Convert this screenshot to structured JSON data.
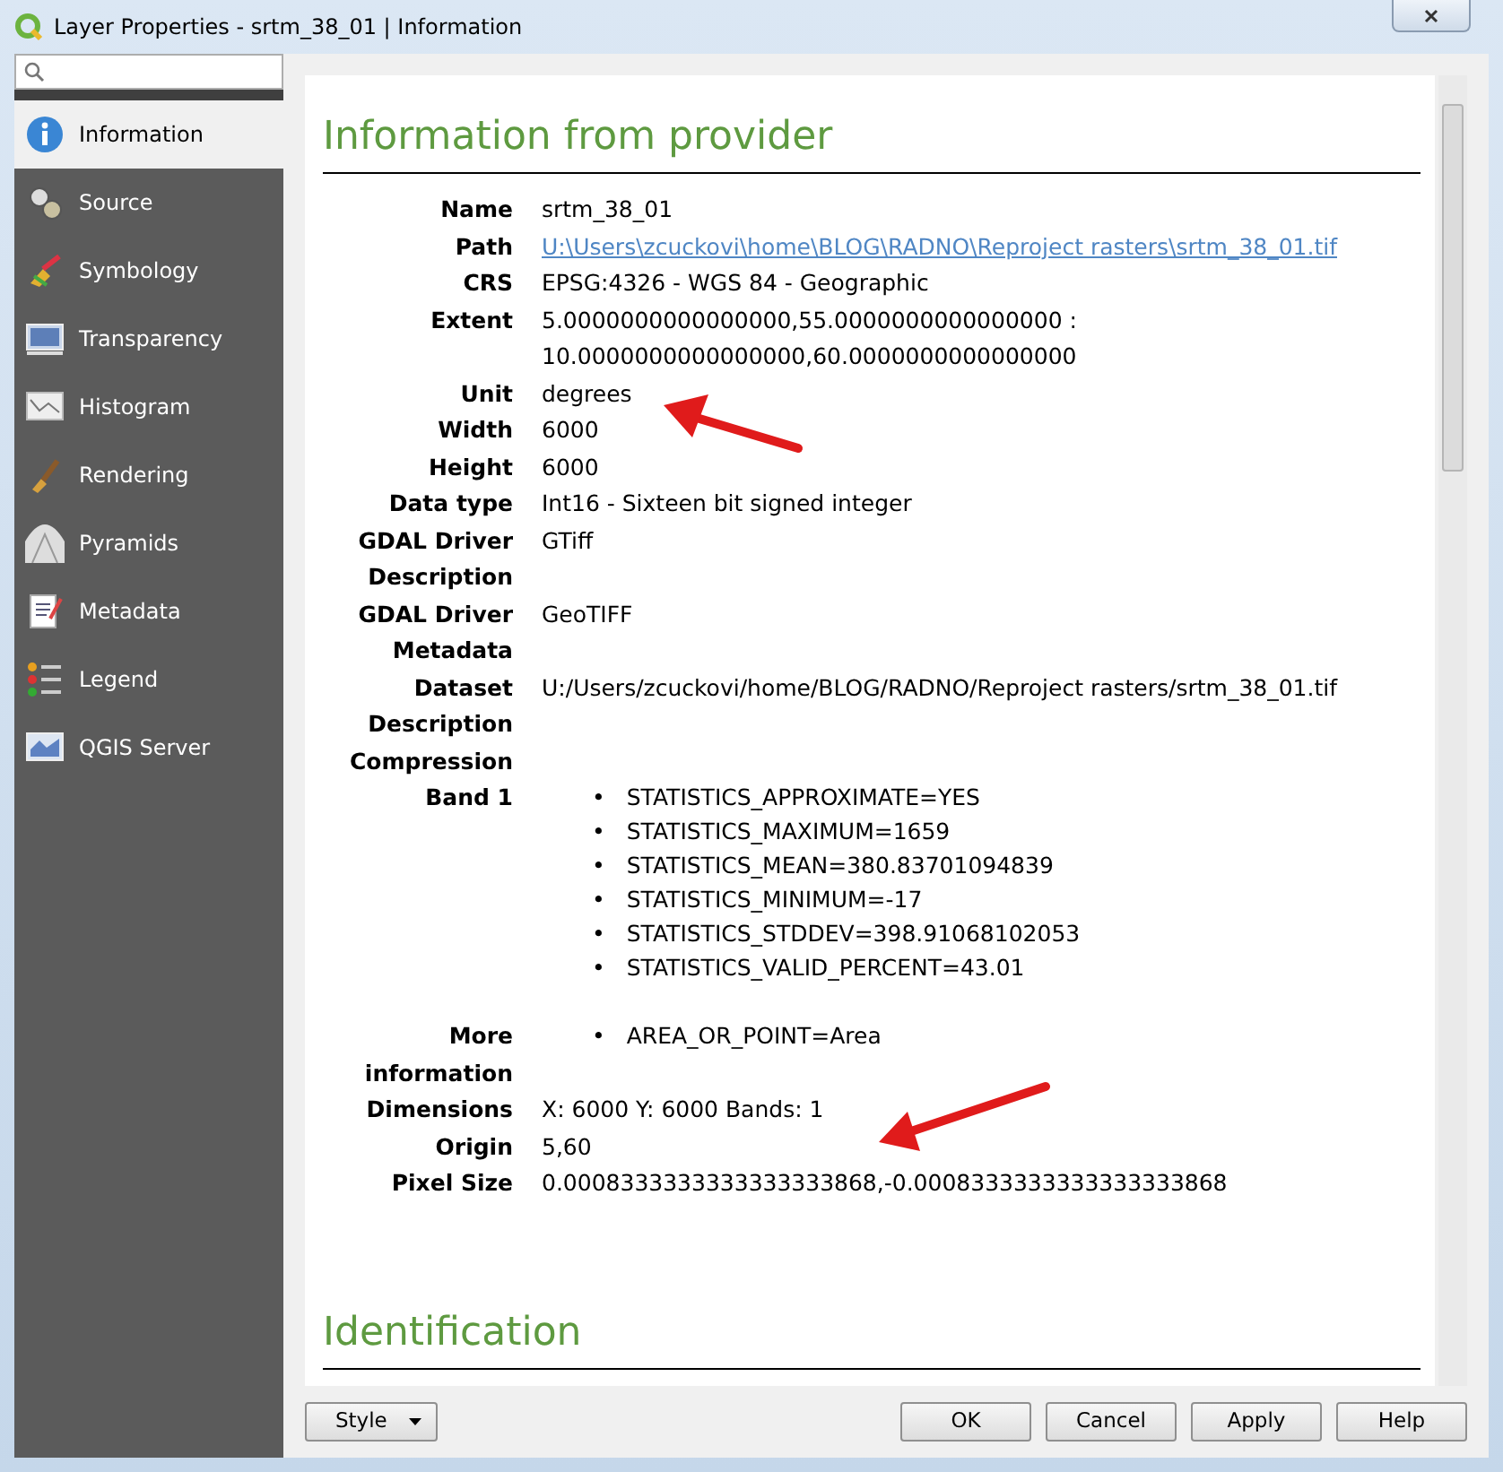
{
  "window": {
    "title": "Layer Properties - srtm_38_01 | Information"
  },
  "sidebar": {
    "items": [
      {
        "label": "Information",
        "selected": true
      },
      {
        "label": "Source",
        "selected": false
      },
      {
        "label": "Symbology",
        "selected": false
      },
      {
        "label": "Transparency",
        "selected": false
      },
      {
        "label": "Histogram",
        "selected": false
      },
      {
        "label": "Rendering",
        "selected": false
      },
      {
        "label": "Pyramids",
        "selected": false
      },
      {
        "label": "Metadata",
        "selected": false
      },
      {
        "label": "Legend",
        "selected": false
      },
      {
        "label": "QGIS Server",
        "selected": false
      }
    ]
  },
  "sections": [
    {
      "heading": "Information from provider",
      "rows": [
        {
          "label": "Name",
          "kind": "text",
          "value": "srtm_38_01"
        },
        {
          "label": "Path",
          "kind": "link",
          "value": "U:\\Users\\zcuckovi\\home\\BLOG\\RADNO\\Reproject rasters\\srtm_38_01.tif"
        },
        {
          "label": "CRS",
          "kind": "text",
          "value": "EPSG:4326 - WGS 84 - Geographic"
        },
        {
          "label": "Extent",
          "kind": "lines",
          "lines": [
            "5.0000000000000000,55.0000000000000000 :",
            "10.0000000000000000,60.0000000000000000"
          ]
        },
        {
          "label": "Unit",
          "kind": "text",
          "value": "degrees"
        },
        {
          "label": "Width",
          "kind": "text",
          "value": "6000"
        },
        {
          "label": "Height",
          "kind": "text",
          "value": "6000"
        },
        {
          "label": "Data type",
          "kind": "text",
          "value": "Int16 - Sixteen bit signed integer"
        },
        {
          "label": "GDAL Driver Description",
          "kind": "text",
          "value": "GTiff"
        },
        {
          "label": "GDAL Driver Metadata",
          "kind": "text",
          "value": "GeoTIFF"
        },
        {
          "label": "Dataset Description",
          "kind": "text",
          "value": "U:/Users/zcuckovi/home/BLOG/RADNO/Reproject rasters/srtm_38_01.tif"
        },
        {
          "label": "Compression",
          "kind": "empty"
        },
        {
          "label": "Band 1",
          "kind": "list",
          "bullet": "•",
          "items": [
            "STATISTICS_APPROXIMATE=YES",
            "STATISTICS_MAXIMUM=1659",
            "STATISTICS_MEAN=380.83701094839",
            "STATISTICS_MINIMUM=-17",
            "STATISTICS_STDDEV=398.91068102053",
            "STATISTICS_VALID_PERCENT=43.01"
          ]
        },
        {
          "label": "More information",
          "kind": "list",
          "bullet": "•",
          "items": [
            "AREA_OR_POINT=Area"
          ]
        },
        {
          "label": "Dimensions",
          "kind": "text",
          "value": "X: 6000 Y: 6000 Bands: 1"
        },
        {
          "label": "Origin",
          "kind": "text",
          "value": "5,60"
        },
        {
          "label": "Pixel Size",
          "kind": "text",
          "value": "0.0008333333333333333868,-0.0008333333333333333868"
        }
      ]
    },
    {
      "heading": "Identification"
    }
  ],
  "buttons": [
    {
      "label": "Style",
      "kind": "dropdown"
    },
    {
      "label": "OK",
      "kind": "push"
    },
    {
      "label": "Cancel",
      "kind": "push"
    },
    {
      "label": "Apply",
      "kind": "push"
    },
    {
      "label": "Help",
      "kind": "push"
    }
  ]
}
